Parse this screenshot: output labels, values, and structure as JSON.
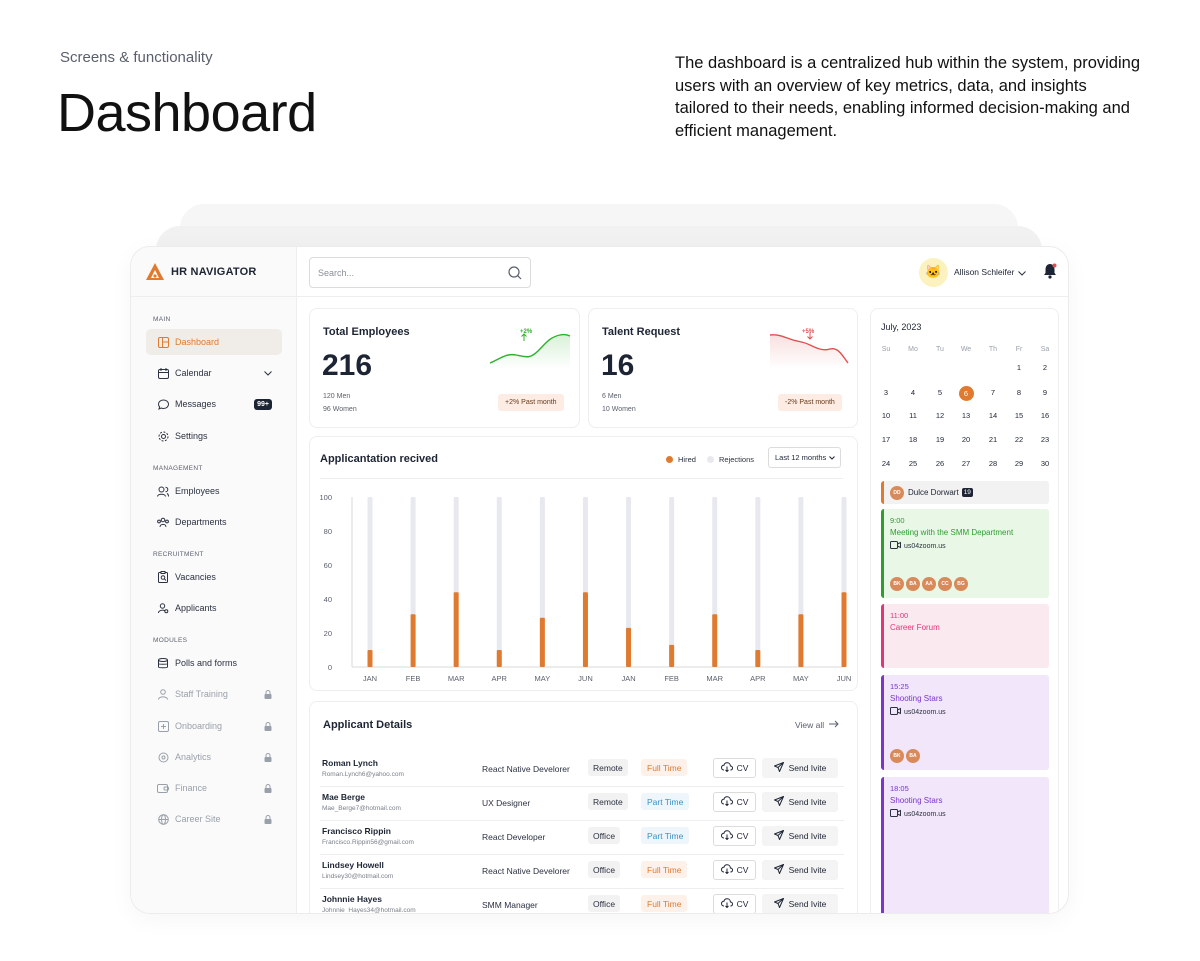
{
  "header": {
    "eyebrow": "Screens & functionality",
    "title": "Dashboard",
    "intro": "The dashboard is a centralized hub within the system, providing users with an overview of key metrics, data, and insights tailored to their needs, enabling informed decision-making and efficient management."
  },
  "brand": {
    "name": "HR NAVIGATOR",
    "accent": "#e07a2f"
  },
  "sidebar": {
    "sections": {
      "main": "MAIN",
      "management": "MANAGEMENT",
      "recruitment": "RECRUITMENT",
      "modules": "MODULES"
    },
    "items": [
      {
        "label": "Dashboard",
        "icon": "layout-icon"
      },
      {
        "label": "Calendar",
        "icon": "calendar-icon"
      },
      {
        "label": "Messages",
        "icon": "chat-icon",
        "badge": "99+"
      },
      {
        "label": "Settings",
        "icon": "gear-icon"
      },
      {
        "label": "Employees",
        "icon": "users-icon"
      },
      {
        "label": "Departments",
        "icon": "team-icon"
      },
      {
        "label": "Vacancies",
        "icon": "clipboard-icon"
      },
      {
        "label": "Applicants",
        "icon": "user-search-icon"
      },
      {
        "label": "Polls and forms",
        "icon": "database-icon"
      },
      {
        "label": "Staff Training",
        "icon": "user-icon"
      },
      {
        "label": "Onboarding",
        "icon": "plus-square-icon"
      },
      {
        "label": "Analytics",
        "icon": "analytics-icon"
      },
      {
        "label": "Finance",
        "icon": "wallet-icon"
      },
      {
        "label": "Career Site",
        "icon": "globe-icon"
      }
    ]
  },
  "topbar": {
    "search_placeholder": "Search...",
    "user_name": "Allison Schleifer",
    "user_emoji": "🐱"
  },
  "stats": {
    "employees": {
      "title": "Total Employees",
      "value": "216",
      "line1": "120 Men",
      "line2": "96 Women",
      "trend": "+2%",
      "chip": "+2% Past month",
      "color": "#2bb32b"
    },
    "talent": {
      "title": "Talent Request",
      "value": "16",
      "line1": "6 Men",
      "line2": "10 Women",
      "trend": "+5%",
      "chip": "-2% Past month",
      "color": "#e05050"
    }
  },
  "applications": {
    "title": "Applicantation recived",
    "legend_hired": "Hired",
    "legend_rejections": "Rejections",
    "range": "Last 12 months",
    "colors": {
      "hired": "#e07a2f",
      "rejections": "#e8e8ef"
    }
  },
  "chart_data": {
    "type": "bar",
    "categories": [
      "JAN",
      "FEB",
      "MAR",
      "APR",
      "MAY",
      "JUN",
      "JAN",
      "FEB",
      "MAR",
      "APR",
      "MAY",
      "JUN"
    ],
    "series": [
      {
        "name": "Hired",
        "values": [
          10,
          31,
          44,
          10,
          29,
          44,
          23,
          13,
          31,
          10,
          31,
          44
        ]
      },
      {
        "name": "Rejections",
        "values": [
          100,
          100,
          100,
          100,
          100,
          100,
          100,
          100,
          100,
          100,
          100,
          100
        ]
      }
    ],
    "yticks": [
      0,
      20,
      40,
      60,
      80,
      100
    ],
    "ylim": [
      0,
      100
    ]
  },
  "details": {
    "title": "Applicant Details",
    "view_all": "View all",
    "cv_label": "CV",
    "invite_label": "Send Ivite",
    "rows": [
      {
        "name": "Roman Lynch",
        "email": "Roman.Lynch6@yahoo.com",
        "role": "React Native Develorer",
        "place": "Remote",
        "type": "Full Time"
      },
      {
        "name": "Mae Berge",
        "email": "Mae_Berge7@hotmail.com",
        "role": "UX Designer",
        "place": "Remote",
        "type": "Part Time"
      },
      {
        "name": "Francisco Rippin",
        "email": "Francisco.Rippin56@gmail.com",
        "role": "React Developer",
        "place": "Office",
        "type": "Part Time"
      },
      {
        "name": "Lindsey Howell",
        "email": "Lindsey30@hotmail.com",
        "role": "React Native Develorer",
        "place": "Office",
        "type": "Full Time"
      },
      {
        "name": "Johnnie Hayes",
        "email": "Johnnie_Hayes34@hotmail.com",
        "role": "SMM Manager",
        "place": "Office",
        "type": "Full Time"
      }
    ]
  },
  "calendar": {
    "month": "July, 2023",
    "weekdays": [
      "Su",
      "Mo",
      "Tu",
      "We",
      "Th",
      "Fr",
      "Sa"
    ],
    "weeks": [
      [
        "",
        "",
        "",
        "",
        "",
        "1",
        "2"
      ],
      [
        "3",
        "4",
        "5",
        "6",
        "7",
        "8",
        "9"
      ],
      [
        "10",
        "11",
        "12",
        "13",
        "14",
        "15",
        "16"
      ],
      [
        "17",
        "18",
        "19",
        "20",
        "21",
        "22",
        "23"
      ],
      [
        "24",
        "25",
        "26",
        "27",
        "28",
        "29",
        "30"
      ]
    ],
    "selected": "6",
    "person": {
      "initials": "DD",
      "name": "Dulce Dorwart",
      "count": "19"
    },
    "events": [
      {
        "time": "9:00",
        "title": "Meeting with the SMM Department",
        "link": "us04zoom.us",
        "avatars": [
          "BK",
          "BA",
          "AA",
          "CC",
          "BG"
        ],
        "color": "#2e9e2e",
        "bg": "#e8f7e6"
      },
      {
        "time": "11:00",
        "title": "Career Forum",
        "link": "",
        "avatars": [],
        "color": "#e0357a",
        "bg": "#fbe9f0"
      },
      {
        "time": "15:25",
        "title": "Shooting Stars",
        "link": "us04zoom.us",
        "avatars": [
          "BK",
          "BA"
        ],
        "color": "#7b35c9",
        "bg": "#f1e6fa"
      },
      {
        "time": "18:05",
        "title": "Shooting Stars",
        "link": "us04zoom.us",
        "avatars": [],
        "color": "#7b35c9",
        "bg": "#f1e6fa"
      }
    ]
  }
}
